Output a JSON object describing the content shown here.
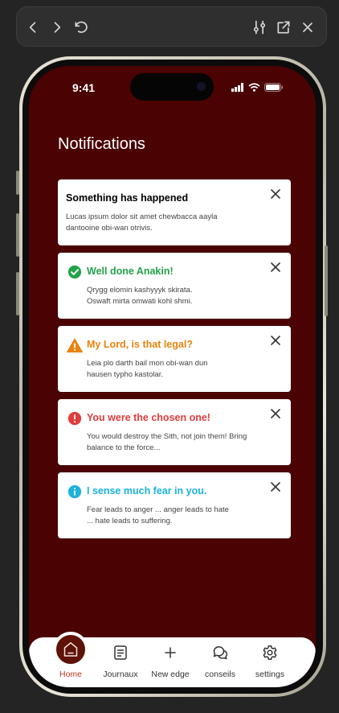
{
  "toolbar": {
    "back_icon": "chevron-left-icon",
    "forward_icon": "chevron-right-icon",
    "reload_icon": "undo-icon",
    "tune_icon": "sliders-icon",
    "external_icon": "open-external-icon",
    "close_icon": "close-icon"
  },
  "status_bar": {
    "time": "9:41"
  },
  "page": {
    "title": "Notifications"
  },
  "notifications": [
    {
      "type": "default",
      "title": "Something has happened",
      "message": "Lucas ipsum dolor sit amet chewbacca aayla dantooine obi-wan otrivis.",
      "color": "#1f1f1f"
    },
    {
      "type": "success",
      "title": "Well done Anakin!",
      "message": "Qrygg elomin kashyyyk skirata. Oswaft mirta omwati kohl shmi.",
      "color": "#22a349"
    },
    {
      "type": "warning",
      "title": "My Lord, is that legal?",
      "message": "Leia plo darth bail mon obi-wan dun hausen typho kastolar.",
      "color": "#e8830f"
    },
    {
      "type": "error",
      "title": "You were the chosen one!",
      "message": "You would destroy the Sith, not join them! Bring balance to the force...",
      "color": "#e23b3b"
    },
    {
      "type": "info",
      "title": "I sense much fear in you.",
      "message": "Fear leads to anger ...  anger leads to hate ... hate leads to suffering.",
      "color": "#1cb2dc"
    }
  ],
  "bottom_nav": {
    "items": [
      {
        "label": "Home",
        "icon": "home-icon",
        "active": true
      },
      {
        "label": "Journaux",
        "icon": "journal-icon",
        "active": false
      },
      {
        "label": "New edge",
        "icon": "plus-icon",
        "active": false
      },
      {
        "label": "conseils",
        "icon": "chat-bubbles-icon",
        "active": false
      },
      {
        "label": "settings",
        "icon": "gear-icon",
        "active": false
      }
    ],
    "active_color": "#c23a1a"
  },
  "colors": {
    "screen_bg": "#4a0202",
    "accent": "#5e1208"
  }
}
